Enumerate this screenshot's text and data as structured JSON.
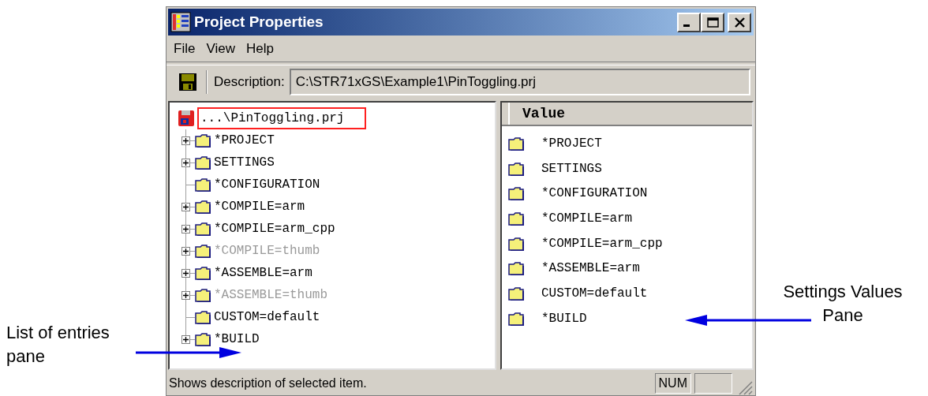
{
  "window": {
    "title": "Project Properties"
  },
  "menu": [
    "File",
    "View",
    "Help"
  ],
  "toolbar": {
    "description_label": "Description:",
    "description_value": "C:\\STR71xGS\\Example1\\PinToggling.prj"
  },
  "tree": {
    "root": {
      "label": "...\\PinToggling.prj",
      "highlighted": true
    },
    "items": [
      {
        "label": "*PROJECT",
        "expandable": true,
        "disabled": false
      },
      {
        "label": "SETTINGS",
        "expandable": true,
        "disabled": false
      },
      {
        "label": "*CONFIGURATION",
        "expandable": false,
        "disabled": false
      },
      {
        "label": "*COMPILE=arm",
        "expandable": true,
        "disabled": false
      },
      {
        "label": "*COMPILE=arm_cpp",
        "expandable": true,
        "disabled": false
      },
      {
        "label": "*COMPILE=thumb",
        "expandable": true,
        "disabled": true
      },
      {
        "label": "*ASSEMBLE=arm",
        "expandable": true,
        "disabled": false
      },
      {
        "label": "*ASSEMBLE=thumb",
        "expandable": true,
        "disabled": true
      },
      {
        "label": "CUSTOM=default",
        "expandable": false,
        "disabled": false
      },
      {
        "label": "*BUILD",
        "expandable": true,
        "disabled": false
      }
    ]
  },
  "values": {
    "header": "Value",
    "items": [
      "*PROJECT",
      "SETTINGS",
      "*CONFIGURATION",
      "*COMPILE=arm",
      "*COMPILE=arm_cpp",
      "*ASSEMBLE=arm",
      "CUSTOM=default",
      "*BUILD"
    ]
  },
  "status_bar": {
    "text": "Shows description of selected item.",
    "num": "NUM"
  },
  "annotations": {
    "left_label": "List of entries\npane",
    "right_label": "Settings Values\nPane"
  }
}
